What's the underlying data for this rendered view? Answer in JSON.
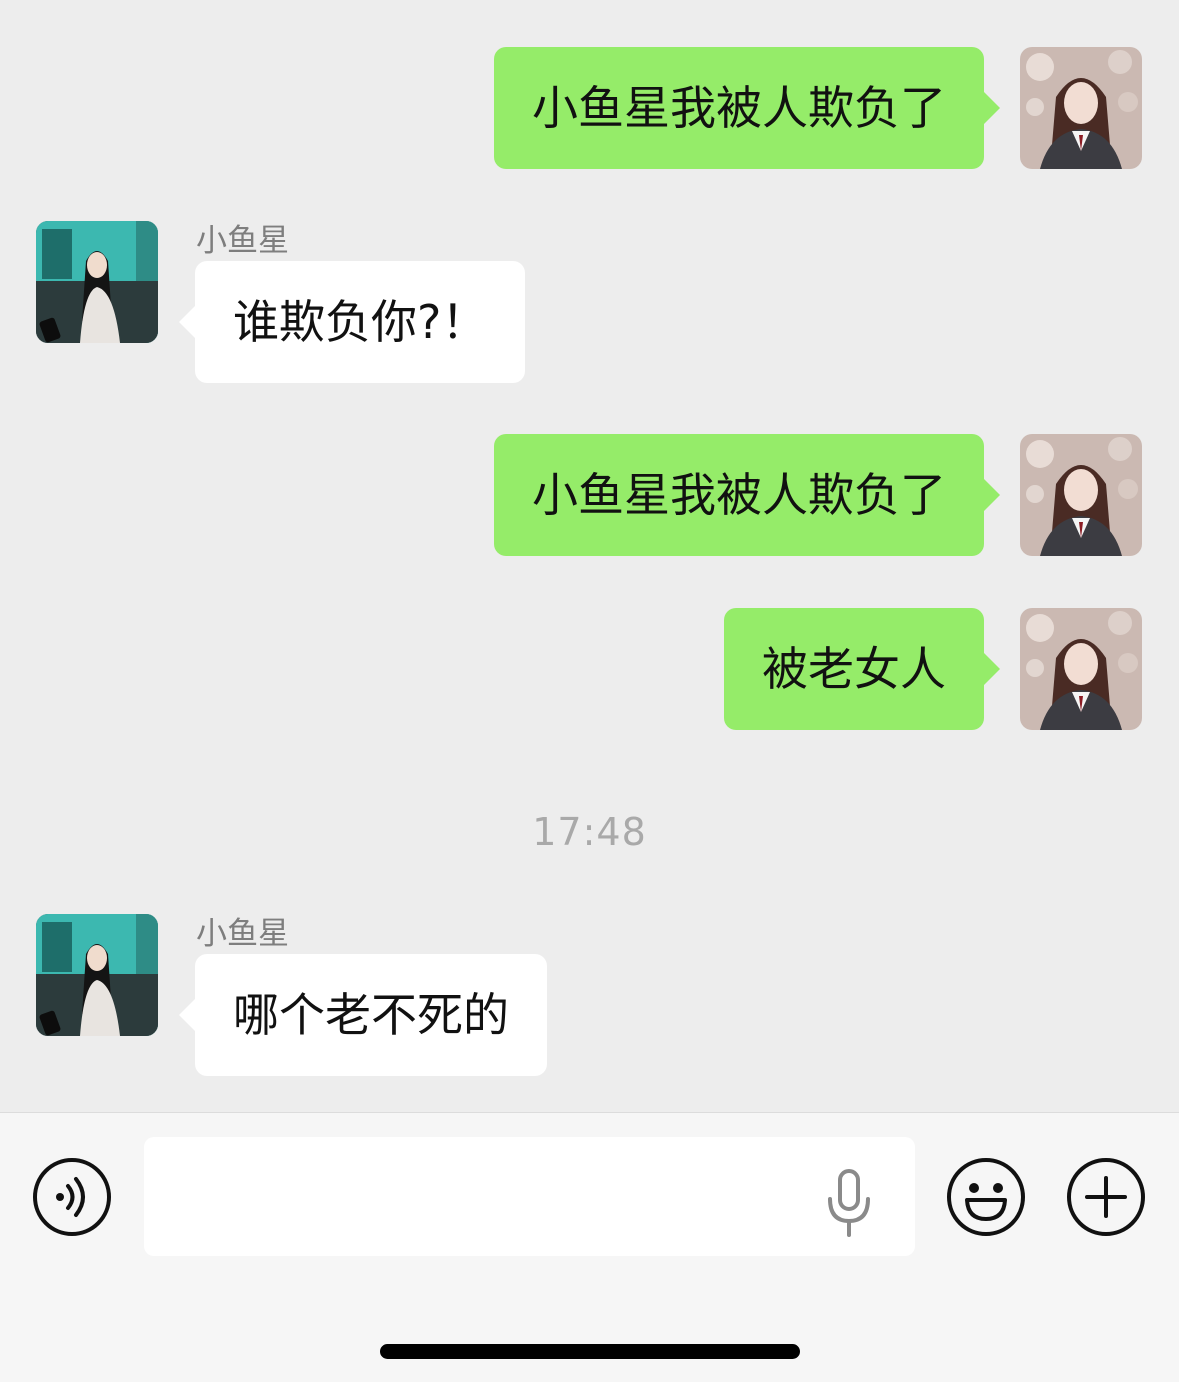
{
  "messages": [
    {
      "side": "me",
      "text": "小鱼星我被人欺负了"
    },
    {
      "side": "them",
      "sender": "小鱼星",
      "text": "谁欺负你?！"
    },
    {
      "side": "me",
      "text": "小鱼星我被人欺负了"
    },
    {
      "side": "me",
      "text": "被老女人"
    },
    {
      "side": "them",
      "sender": "小鱼星",
      "text": "哪个老不死的"
    }
  ],
  "timestamp": "17:48",
  "input": {
    "value": "",
    "placeholder": ""
  },
  "icons": {
    "voice": "voice-toggle-icon",
    "mic": "microphone-icon",
    "emoji": "emoji-icon",
    "plus": "plus-icon"
  },
  "colors": {
    "background": "#ededed",
    "my_bubble": "#95ec69",
    "their_bubble": "#ffffff",
    "input_bar": "#f6f6f6"
  }
}
